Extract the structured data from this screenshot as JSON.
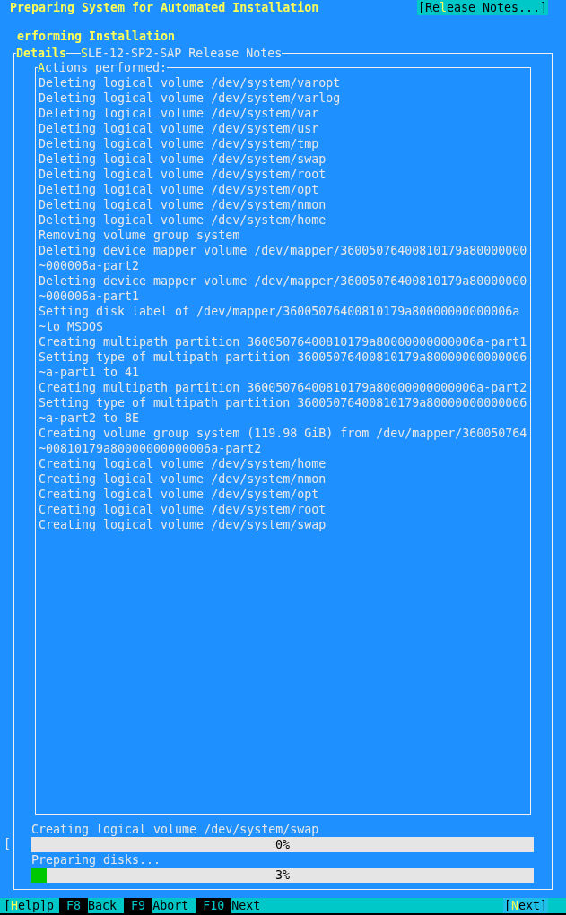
{
  "title": "Preparing System for Automated Installation",
  "release_notes_button": {
    "before": "[Re",
    "hotkey": "l",
    "after": "ease Notes...]"
  },
  "section_title": "erforming Installation",
  "tabs": [
    {
      "hotkey": "D",
      "after": "etails",
      "selected": true
    },
    {
      "hotkey": "S",
      "after": "LE-12-SP2-SAP Release Notes",
      "selected": false
    }
  ],
  "log": {
    "label": {
      "hotkey": "A",
      "after": "ctions performed:"
    },
    "lines": [
      "Deleting logical volume /dev/system/varopt",
      "Deleting logical volume /dev/system/varlog",
      "Deleting logical volume /dev/system/var",
      "Deleting logical volume /dev/system/usr",
      "Deleting logical volume /dev/system/tmp",
      "Deleting logical volume /dev/system/swap",
      "Deleting logical volume /dev/system/root",
      "Deleting logical volume /dev/system/opt",
      "Deleting logical volume /dev/system/nmon",
      "Deleting logical volume /dev/system/home",
      "Removing volume group system",
      "Deleting device mapper volume /dev/mapper/36005076400810179a80000000",
      "~000006a-part2",
      "Deleting device mapper volume /dev/mapper/36005076400810179a80000000",
      "~000006a-part1",
      "Setting disk label of /dev/mapper/36005076400810179a80000000000006a",
      "~to MSDOS",
      "Creating multipath partition 36005076400810179a80000000000006a-part1",
      "Setting type of multipath partition 36005076400810179a80000000000006",
      "~a-part1 to 41",
      "Creating multipath partition 36005076400810179a80000000000006a-part2",
      "Setting type of multipath partition 36005076400810179a80000000000006",
      "~a-part2 to 8E",
      "Creating volume group system (119.98 GiB) from /dev/mapper/360050764",
      "~00810179a80000000000006a-part2",
      "Creating logical volume /dev/system/home",
      "Creating logical volume /dev/system/nmon",
      "Creating logical volume /dev/system/opt",
      "Creating logical volume /dev/system/root",
      "Creating logical volume /dev/system/swap"
    ]
  },
  "progress": [
    {
      "label": "Creating logical volume /dev/system/swap",
      "level": 0,
      "reading": "0%"
    },
    {
      "label": "Preparing disks...",
      "level": 0.03,
      "reading": "3%"
    }
  ],
  "stray_bracket": "[",
  "help_button": {
    "before": "[",
    "hotkey": "H",
    "after": "elp]p"
  },
  "function_keys": [
    {
      "key": "F8",
      "label": "Back"
    },
    {
      "key": "F9",
      "label": "Abort"
    },
    {
      "key": "F10",
      "label": "Next"
    }
  ],
  "next_button": {
    "before": "[",
    "hotkey": "N",
    "after": "ext]"
  }
}
